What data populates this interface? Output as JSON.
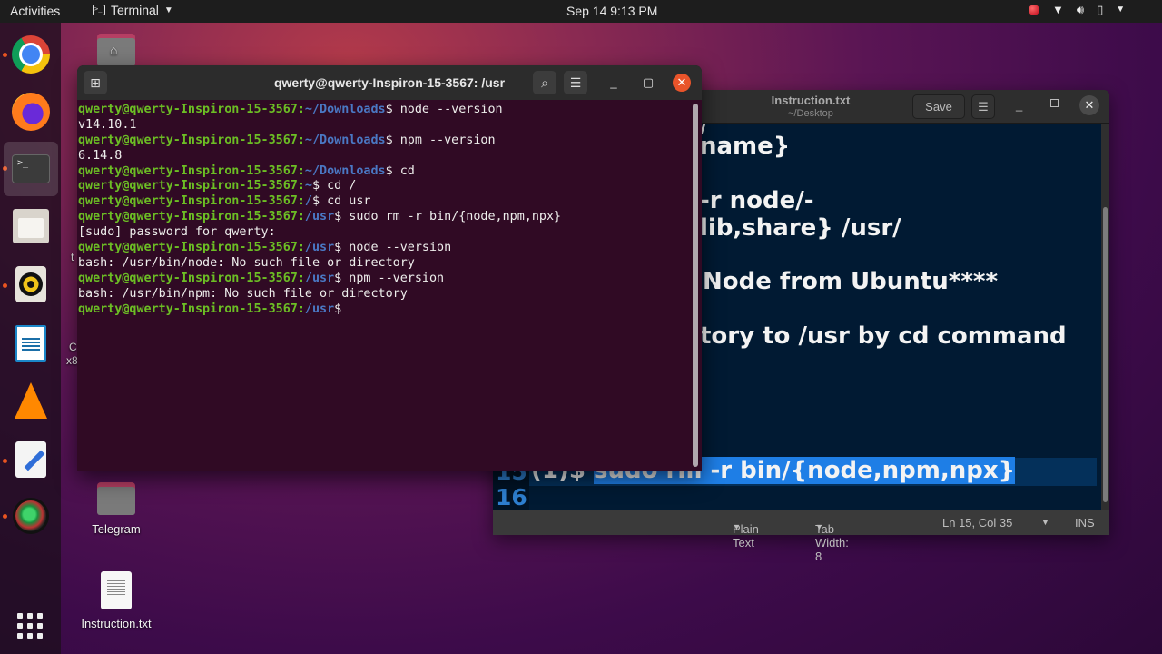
{
  "topbar": {
    "activities": "Activities",
    "app_name": "Terminal",
    "clock": "Sep 14  9:13 PM",
    "tray": [
      "record-indicator",
      "wifi-icon",
      "volume-icon",
      "battery-icon",
      "system-menu-arrow"
    ]
  },
  "dock": {
    "items": [
      {
        "name": "Google Chrome",
        "icon": "chrome-icon",
        "running": true
      },
      {
        "name": "Firefox",
        "icon": "firefox-icon",
        "running": false
      },
      {
        "name": "Terminal",
        "icon": "terminal-icon",
        "running": true,
        "active": true,
        "glyph": ">_"
      },
      {
        "name": "Files",
        "icon": "files-icon",
        "running": false
      },
      {
        "name": "Rhythmbox",
        "icon": "rhythmbox-icon",
        "running": true
      },
      {
        "name": "LibreOffice Writer",
        "icon": "writer-icon",
        "running": false
      },
      {
        "name": "VLC",
        "icon": "vlc-icon",
        "running": false
      },
      {
        "name": "Text Editor",
        "icon": "gedit-icon",
        "running": true
      },
      {
        "name": "Camera",
        "icon": "camera-icon",
        "running": true
      }
    ],
    "show_apps": "apps-grid-icon"
  },
  "desktop": {
    "icons": [
      {
        "label": "",
        "icon": "home-folder-icon"
      },
      {
        "label": "Telegram",
        "icon": "folder-icon"
      },
      {
        "label": "Instruction.txt",
        "icon": "text-file-icon"
      }
    ],
    "partial_labels": [
      "t",
      "C",
      "x8"
    ]
  },
  "terminal": {
    "title": "qwerty@qwerty-Inspiron-15-3567: /usr",
    "lines": [
      {
        "user": "qwerty@qwerty-Inspiron-15-3567",
        "path": "~/Downloads",
        "cmd": " node --version"
      },
      {
        "out": "v14.10.1"
      },
      {
        "user": "qwerty@qwerty-Inspiron-15-3567",
        "path": "~/Downloads",
        "cmd": " npm --version"
      },
      {
        "out": "6.14.8"
      },
      {
        "user": "qwerty@qwerty-Inspiron-15-3567",
        "path": "~/Downloads",
        "cmd": " cd"
      },
      {
        "user": "qwerty@qwerty-Inspiron-15-3567",
        "path": "~",
        "cmd": " cd /"
      },
      {
        "user": "qwerty@qwerty-Inspiron-15-3567",
        "path": "/",
        "cmd": " cd usr"
      },
      {
        "user": "qwerty@qwerty-Inspiron-15-3567",
        "path": "/usr",
        "cmd": " sudo rm -r bin/{node,npm,npx}"
      },
      {
        "out": "[sudo] password for qwerty:"
      },
      {
        "user": "qwerty@qwerty-Inspiron-15-3567",
        "path": "/usr",
        "cmd": " node --version"
      },
      {
        "out": "bash: /usr/bin/node: No such file or directory"
      },
      {
        "user": "qwerty@qwerty-Inspiron-15-3567",
        "path": "/usr",
        "cmd": " npm --version"
      },
      {
        "out": "bash: /usr/bin/npm: No such file or directory"
      },
      {
        "user": "qwerty@qwerty-Inspiron-15-3567",
        "path": "/usr",
        "cmd": ""
      }
    ]
  },
  "editor": {
    "title": "Instruction.txt",
    "subtitle": "~/Desktop",
    "save_label": "Save",
    "visible_lines": [
      "/",
      "name}",
      "",
      "-r node/-",
      "lib,share} /usr/",
      "",
      "Node from Ubuntu****",
      "",
      "tory to /usr by cd command"
    ],
    "line15_number": "15",
    "line15_prefix": "(1)$ ",
    "line15_selected": "sudo rm -r bin/{node,npm,npx}",
    "line16_number": "16",
    "status": {
      "language": "Plain Text",
      "tab_width": "Tab Width: 8",
      "position": "Ln 15, Col 35",
      "mode": "INS"
    }
  },
  "colors": {
    "terminal_bg": "#300a24",
    "prompt_user": "#6cbe24",
    "prompt_path": "#4a78c4",
    "editor_bg": "#011a33",
    "selection": "#1e7ee6",
    "close_button": "#e9542a"
  }
}
